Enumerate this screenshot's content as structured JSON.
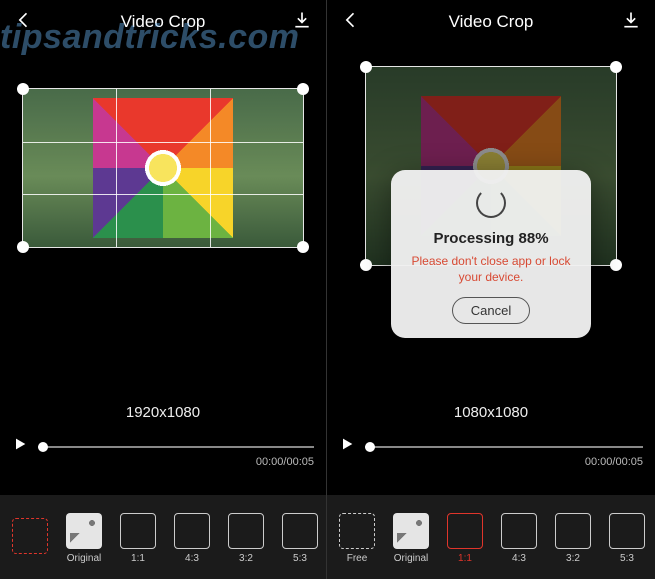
{
  "watermark": "tipsandtricks.com",
  "header": {
    "title": "Video Crop"
  },
  "left": {
    "dimensions": "1920x1080",
    "time": {
      "current": "00:00",
      "total": "00:05"
    },
    "tools": [
      {
        "id": "free",
        "label": "",
        "style": "dashed",
        "selected": true
      },
      {
        "id": "original",
        "label": "Original",
        "style": "image",
        "selected": false
      },
      {
        "id": "1to1",
        "label": "1:1",
        "style": "solid",
        "selected": false
      },
      {
        "id": "4to3",
        "label": "4:3",
        "style": "solid",
        "selected": false
      },
      {
        "id": "3to2",
        "label": "3:2",
        "style": "solid",
        "selected": false
      },
      {
        "id": "5to3",
        "label": "5:3",
        "style": "solid",
        "selected": false
      }
    ]
  },
  "right": {
    "dimensions": "1080x1080",
    "time": {
      "current": "00:00",
      "total": "00:05"
    },
    "tools": [
      {
        "id": "free",
        "label": "Free",
        "style": "dashed",
        "selected": false
      },
      {
        "id": "original",
        "label": "Original",
        "style": "image",
        "selected": false
      },
      {
        "id": "1to1",
        "label": "1:1",
        "style": "solid",
        "selected": true
      },
      {
        "id": "4to3",
        "label": "4:3",
        "style": "solid",
        "selected": false
      },
      {
        "id": "3to2",
        "label": "3:2",
        "style": "solid",
        "selected": false
      },
      {
        "id": "5to3",
        "label": "5:3",
        "style": "solid",
        "selected": false
      }
    ],
    "modal": {
      "title": "Processing 88%",
      "subtitle": "Please don't close app or lock your device.",
      "cancel": "Cancel"
    }
  }
}
